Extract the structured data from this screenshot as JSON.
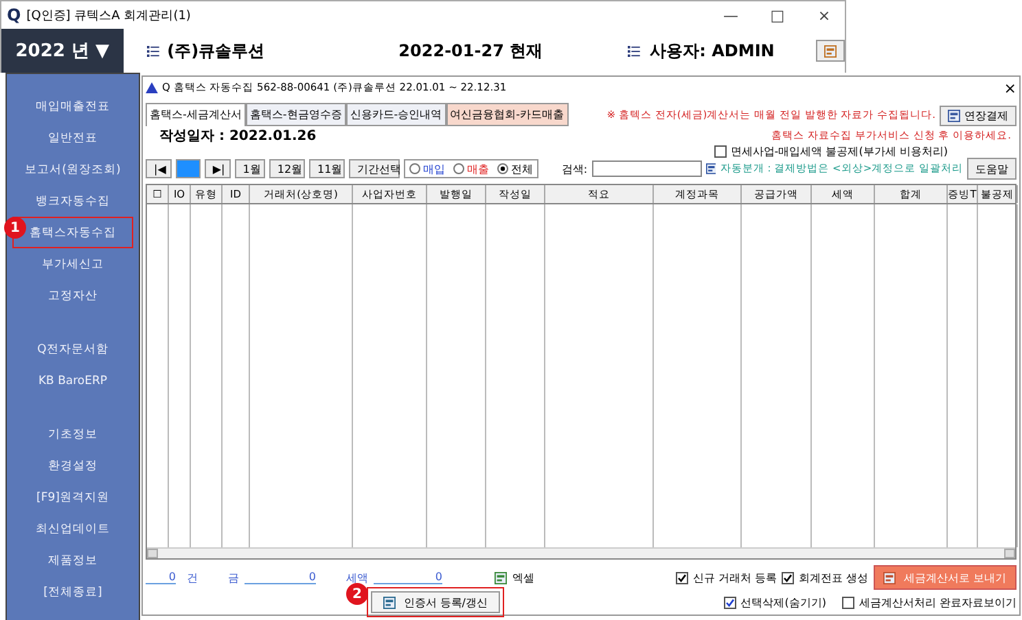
{
  "window": {
    "logo": "Q",
    "title": "[Q인증] 큐텍스A  회계관리(1)",
    "controls": [
      "—",
      "□",
      "×"
    ]
  },
  "header": {
    "year": "2022 년 ▼",
    "company": "(주)큐솔루션",
    "date": "2022-01-27 현재",
    "user": "사용자: ADMIN"
  },
  "sidebar": {
    "groups": [
      [
        {
          "label": "매입매출전표",
          "selected": false
        },
        {
          "label": "일반전표",
          "selected": false
        },
        {
          "label": "보고서(원장조회)",
          "selected": false
        },
        {
          "label": "뱅크자동수집",
          "selected": false
        },
        {
          "label": "홈택스자동수집",
          "selected": true,
          "badge": "1"
        },
        {
          "label": "부가세신고",
          "selected": false
        },
        {
          "label": "고정자산",
          "selected": false
        }
      ],
      [
        {
          "label": "Q전자문서함",
          "selected": false
        },
        {
          "label": "KB BaroERP",
          "selected": false
        }
      ],
      [
        {
          "label": "기초정보",
          "selected": false
        },
        {
          "label": "환경설정",
          "selected": false
        },
        {
          "label": "[F9]원격지원",
          "selected": false
        },
        {
          "label": "최신업데이트",
          "selected": false
        },
        {
          "label": "제품정보",
          "selected": false
        },
        {
          "label": "[전체종료]",
          "selected": false
        }
      ]
    ]
  },
  "dialog": {
    "title": "Q 홈택스 자동수집 562-88-00641  (주)큐솔루션  22.01.01 ~ 22.12.31",
    "close": "×",
    "tabs": [
      {
        "label": "홈택스-세금계산서",
        "selected": true
      },
      {
        "label": "홈택스-현금영수증",
        "selected": false
      },
      {
        "label": "신용카드-승인내역",
        "selected": false
      },
      {
        "label": "여신금융협회-카드매출",
        "selected": false
      }
    ],
    "notice": "※ 홈텍스 전자(세금)계산서는 매월 전일 발행한 자료가 수집됩니다.",
    "extend_button": "연장결제",
    "date_label": "작성일자  : 2022.01.26",
    "service_notice": "홈택스 자료수집 부가서비스 신청 후 이용하세요.",
    "tax_exempt": {
      "label": "면세사업-매입세액 불공제(부가세 비용처리)",
      "checked": false
    },
    "nav_buttons": [
      {
        "label": "|◀",
        "selected": false
      },
      {
        "selected": true
      },
      {
        "label": "▶|",
        "selected": false
      },
      {
        "label": "1월",
        "selected": false
      },
      {
        "label": "12월",
        "selected": false
      },
      {
        "label": "11월",
        "selected": false
      },
      {
        "label": "기간선택",
        "selected": false
      }
    ],
    "radios": [
      {
        "label": "매입",
        "selected": false,
        "color": "#1f3fd0"
      },
      {
        "label": "매출",
        "selected": false,
        "color": "#e02020"
      },
      {
        "label": "전체",
        "selected": true,
        "color": "#000000"
      }
    ],
    "search": {
      "label": "검색:"
    },
    "auto_journal": "자동분개 : 결제방법은 <외상>계정으로 일괄처리",
    "help_button": "도움말",
    "table": {
      "columns": [
        "☐",
        "IO",
        "유형",
        "ID",
        "거래처(상호명)",
        "사업자번호",
        "발행일",
        "작성일",
        "적요",
        "계정과목",
        "공급가액",
        "세액",
        "합계",
        "증빙T",
        "불공제"
      ]
    },
    "totals": [
      {
        "value": "0",
        "unit": "건"
      },
      {
        "label": "금",
        "value": "0"
      },
      {
        "label": "세액",
        "value": "0"
      }
    ],
    "excel": "엑셀",
    "cert_button": {
      "label": "인증서 등록/갱신",
      "badge": "2"
    },
    "options": [
      {
        "label": "신규 거래처 등록",
        "checked": true
      },
      {
        "label": "회계전표 생성",
        "checked": true
      }
    ],
    "send_button": "세금계산서로 보내기",
    "options2": [
      {
        "label": "선택삭제(숨기기)",
        "checked": true
      },
      {
        "label": "세금계산서처리 완료자료보이기",
        "checked": false
      }
    ]
  }
}
